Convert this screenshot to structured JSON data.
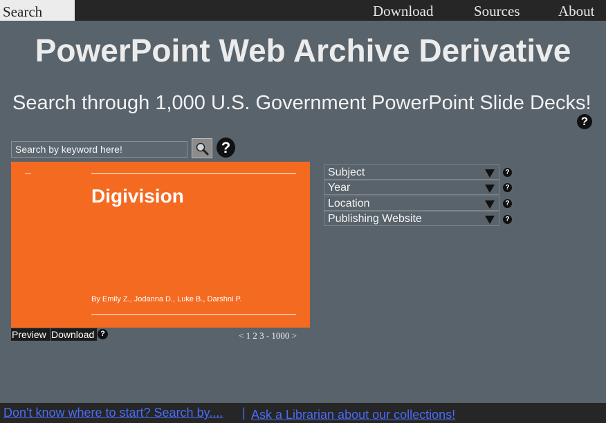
{
  "nav": {
    "search_tab": "Search",
    "links": [
      "Download",
      "Sources",
      "About"
    ]
  },
  "header": {
    "title": "PowerPoint Web Archive Derivative",
    "subtitle": "Search through 1,000 U.S. Government PowerPoint Slide Decks!",
    "help_glyph": "?"
  },
  "search": {
    "placeholder": "Search by keyword here!",
    "value": "",
    "button_icon": "magnifier-icon",
    "help_glyph": "?"
  },
  "result": {
    "slide_title": "Digivision",
    "slide_byline": "By Emily Z., Jodanna D., Luke B., Darshni P.",
    "slide_color": "#f46a21",
    "preview_label": "Preview",
    "download_label": "Download",
    "help_glyph": "?"
  },
  "pagination": {
    "text": "< 1 2 3 - 1000 >"
  },
  "filters": [
    {
      "label": "Subject",
      "help_glyph": "?"
    },
    {
      "label": "Year",
      "help_glyph": "?"
    },
    {
      "label": "Location",
      "help_glyph": "?"
    },
    {
      "label": "Publishing Website",
      "help_glyph": "?"
    }
  ],
  "footer": {
    "link1": "Don't know where to start? Search by....",
    "separator": "|",
    "link2": "Ask a Librarian about our collections!"
  },
  "colors": {
    "background": "#59636b",
    "topbar": "#262626",
    "link": "#4b6cf5"
  }
}
